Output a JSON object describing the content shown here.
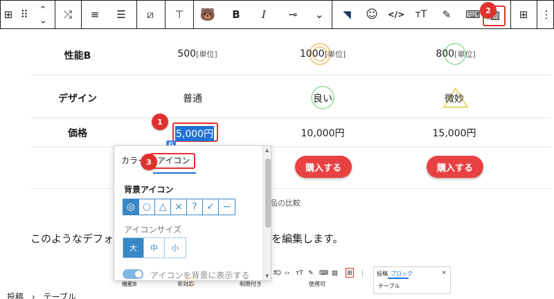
{
  "toolbar": {
    "buttons": [
      {
        "name": "table-icon",
        "glyph": "⊞"
      },
      {
        "name": "drag-handle-icon",
        "glyph": "⠿"
      },
      {
        "name": "move-up-down-icon",
        "glyph": "⌃"
      },
      {
        "name": "transform-icon",
        "glyph": "⤮"
      },
      {
        "name": "align-center-icon",
        "glyph": "≡"
      },
      {
        "name": "align-text-icon",
        "glyph": "☰"
      },
      {
        "name": "no-color-icon",
        "glyph": "⧄"
      },
      {
        "name": "vertical-align-icon",
        "glyph": "⊤"
      },
      {
        "name": "bear-plugin-icon",
        "glyph": "🐻"
      },
      {
        "name": "bold-icon",
        "glyph": "B"
      },
      {
        "name": "italic-icon",
        "glyph": "I"
      },
      {
        "name": "link-icon",
        "glyph": "⊸"
      },
      {
        "name": "more-chevron-icon",
        "glyph": "⌄"
      },
      {
        "name": "brush-icon",
        "glyph": "◥"
      },
      {
        "name": "emoji-icon",
        "glyph": "☺"
      },
      {
        "name": "code-icon",
        "glyph": "</>"
      },
      {
        "name": "text-size-icon",
        "glyph": "тT"
      },
      {
        "name": "highlighter-icon",
        "glyph": "✎"
      },
      {
        "name": "keyboard-icon",
        "glyph": "⌨"
      },
      {
        "name": "cell-icon-setting-icon",
        "glyph": "▨"
      },
      {
        "name": "table-settings-icon",
        "glyph": "⊞"
      },
      {
        "name": "more-options-icon",
        "glyph": "⋮"
      }
    ]
  },
  "table": {
    "rows": [
      {
        "label": "性能B",
        "cells": [
          {
            "text": "500",
            "unit": "[単位]",
            "icon": "none"
          },
          {
            "text": "1000",
            "unit": "[単位]",
            "icon": "double-circle"
          },
          {
            "text": "800",
            "unit": "[単位]",
            "icon": "circle"
          }
        ]
      },
      {
        "label": "デザイン",
        "cells": [
          {
            "text": "普通",
            "unit": "",
            "icon": "none"
          },
          {
            "text": "良い",
            "unit": "",
            "icon": "circle"
          },
          {
            "text": "微妙",
            "unit": "",
            "icon": "triangle"
          }
        ]
      },
      {
        "label": "価格",
        "cells": [
          {
            "text": "5,000円",
            "unit": "",
            "icon": "none"
          },
          {
            "text": "10,000円",
            "unit": "",
            "icon": "none"
          },
          {
            "text": "15,000円",
            "unit": "",
            "icon": "none"
          }
        ]
      }
    ],
    "buy_label": "購入する",
    "caption_tail": "品の比較"
  },
  "badges": {
    "one": "1",
    "two": "2",
    "three": "3"
  },
  "paragraph": {
    "head": "このようなデフォ",
    "tail": "れを編集します。"
  },
  "popover": {
    "tab_color": "カラー",
    "tab_icon": "アイコン",
    "bg_icon_title": "背景アイコン",
    "icons": [
      "◎",
      "○",
      "△",
      "×",
      "?",
      "✓",
      "−"
    ],
    "size_title": "アイコンサイズ",
    "sizes": [
      "大",
      "中",
      "小"
    ],
    "toggle_label": "アイコンを背景に表示する"
  },
  "thumb": {
    "row_label": "機能B",
    "c1": "非対応",
    "c2": "制限付き",
    "c3": "使用可",
    "panel_tab1": "投稿",
    "panel_tab2": "ブロック",
    "panel_close": "×",
    "panel_item": "テーブル"
  },
  "breadcrumb": {
    "a": "投稿",
    "sep": "›",
    "b": "テーブル"
  },
  "colors": {
    "accent": "#e0312f",
    "selection": "#2271d6",
    "button": "#e84142"
  }
}
